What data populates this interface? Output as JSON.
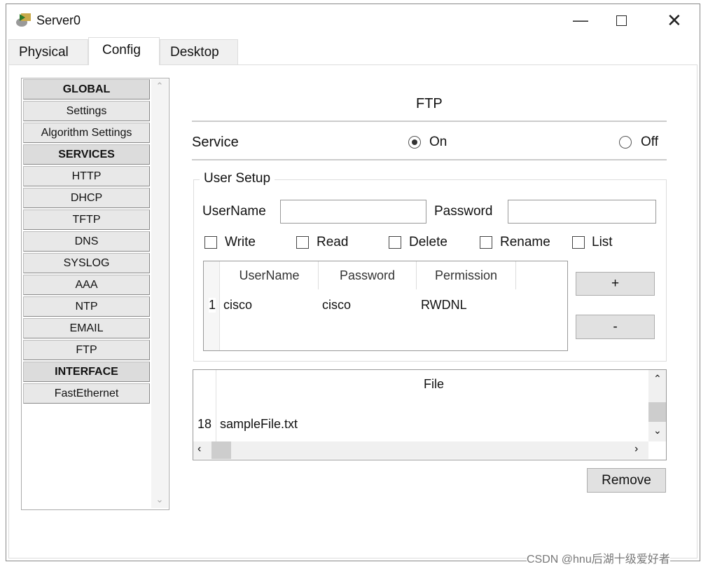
{
  "window": {
    "title": "Server0",
    "icon": "server-icon",
    "controls": [
      "minimize",
      "maximize",
      "close"
    ]
  },
  "tabs": [
    {
      "label": "Physical"
    },
    {
      "label": "Config",
      "active": true
    },
    {
      "label": "Desktop"
    }
  ],
  "sidebar": {
    "items": [
      {
        "label": "GLOBAL",
        "header": true
      },
      {
        "label": "Settings"
      },
      {
        "label": "Algorithm Settings"
      },
      {
        "label": "SERVICES",
        "header": true
      },
      {
        "label": "HTTP"
      },
      {
        "label": "DHCP"
      },
      {
        "label": "TFTP"
      },
      {
        "label": "DNS"
      },
      {
        "label": "SYSLOG"
      },
      {
        "label": "AAA"
      },
      {
        "label": "NTP"
      },
      {
        "label": "EMAIL"
      },
      {
        "label": "FTP",
        "selected": true
      },
      {
        "label": "INTERFACE",
        "header": true
      },
      {
        "label": "FastEthernet"
      }
    ]
  },
  "ftp": {
    "title": "FTP",
    "service_label": "Service",
    "on_label": "On",
    "off_label": "Off",
    "service_value": "On",
    "user_setup": {
      "legend": "User Setup",
      "username_label": "UserName",
      "username_value": "",
      "password_label": "Password",
      "password_value": "",
      "permissions": [
        {
          "label": "Write",
          "checked": false
        },
        {
          "label": "Read",
          "checked": false
        },
        {
          "label": "Delete",
          "checked": false
        },
        {
          "label": "Rename",
          "checked": false
        },
        {
          "label": "List",
          "checked": false
        }
      ],
      "table": {
        "columns": [
          "UserName",
          "Password",
          "Permission"
        ],
        "rows": [
          {
            "index": "1",
            "username": "cisco",
            "password": "cisco",
            "permission": "RWDNL"
          }
        ]
      },
      "add_label": "+",
      "remove_label": "-"
    },
    "files": {
      "column": "File",
      "rows": [
        {
          "index": "18",
          "name": "sampleFile.txt"
        }
      ]
    },
    "remove_label": "Remove"
  },
  "watermark": "CSDN @hnu后湖十级爱好者"
}
